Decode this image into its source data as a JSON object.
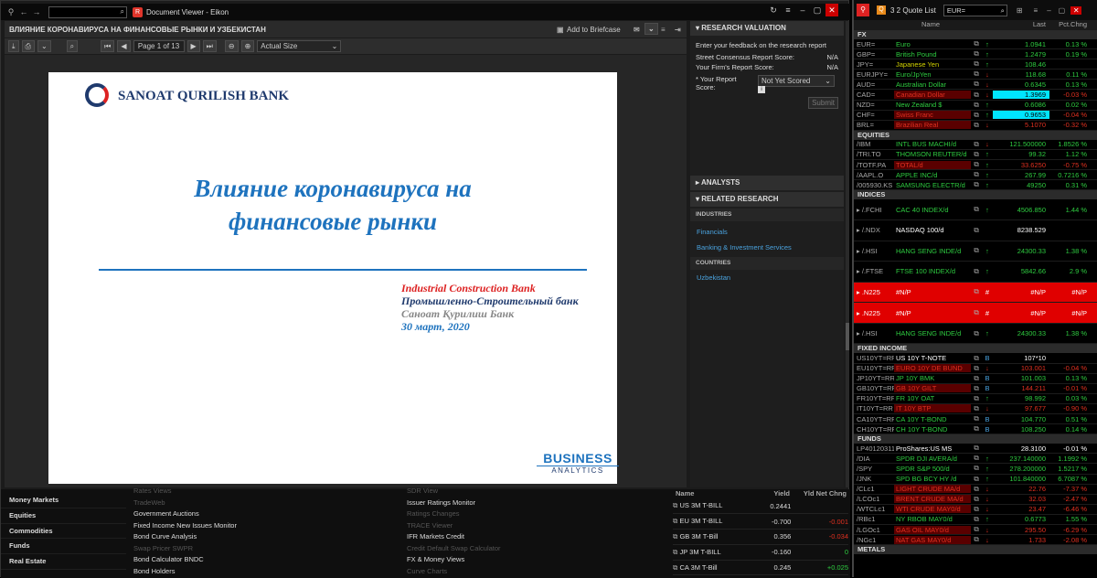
{
  "viewer": {
    "title": "Document Viewer - Eikon",
    "header": "ВЛИЯНИЕ КОРОНАВИРУСА НА ФИНАНСОВЫЕ РЫНКИ И УЗБЕКИСТАН",
    "briefcase": "Add to Briefcase",
    "page_label": "Page 1 of 13",
    "zoom": "Actual Size"
  },
  "doc": {
    "bank": "SANOAT QURILISH BANK",
    "title1": "Влияние коронавируса на",
    "title2": "финансовые рынки",
    "org_en": "Industrial Construction Bank",
    "org_ru": "Промышленно-Строительный банк",
    "org_uz": "Саноат Қурилиш Банк",
    "date": "30 март, 2020",
    "brand1": "BUSINESS",
    "brand2": "ANALYTICS"
  },
  "side": {
    "valuation": "RESEARCH VALUATION",
    "feedback": "Enter your feedback on the research report",
    "street_label": "Street Consensus Report Score:",
    "street_val": "N/A",
    "firm_label": "Your Firm's Report Score:",
    "firm_val": "N/A",
    "your_label": "* Your Report",
    "score_label": "Score:",
    "not_scored": "Not Yet Scored",
    "submit": "Submit",
    "analysts": "ANALYSTS",
    "related": "RELATED RESEARCH",
    "industries": "INDUSTRIES",
    "ind1": "Financials",
    "ind2": "Banking & Investment Services",
    "countries": "COUNTRIES",
    "country1": "Uzbekistan"
  },
  "bottom": {
    "cats": [
      "Money Markets",
      "Equities",
      "Commodities",
      "Funds",
      "Real Estate"
    ],
    "menu1": [
      {
        "t": "Rates Views",
        "dim": true
      },
      {
        "t": "TradeWeb",
        "dim": true
      },
      {
        "t": "Government Auctions",
        "dim": false
      },
      {
        "t": "Fixed Income New Issues Monitor",
        "dim": false
      },
      {
        "t": "Bond Curve Analysis",
        "dim": false
      },
      {
        "t": "Swap Pricer SWPR",
        "dim": true
      },
      {
        "t": "Bond Calculator BNDC",
        "dim": false
      },
      {
        "t": "Bond Holders",
        "dim": false
      }
    ],
    "menu2": [
      {
        "t": "SDR View",
        "dim": true
      },
      {
        "t": "Issuer Ratings Monitor",
        "dim": false
      },
      {
        "t": "Ratings Changes",
        "dim": true
      },
      {
        "t": "TRACE Viewer",
        "dim": true
      },
      {
        "t": "IFR Markets Credit",
        "dim": false
      },
      {
        "t": "Credit Default Swap Calculator",
        "dim": true
      },
      {
        "t": "FX & Money Views",
        "dim": false
      },
      {
        "t": "Curve Charts",
        "dim": true
      }
    ],
    "yh": [
      "Name",
      "Yield",
      "Yld Net Chng"
    ],
    "yields": [
      [
        "US 3M T-BILL",
        "0.2441",
        ""
      ],
      [
        "EU 3M T-BILL",
        "-0.700",
        "-0.001"
      ],
      [
        "GB 3M T-Bill",
        "0.356",
        "-0.034"
      ],
      [
        "JP 3M T-BILL",
        "-0.160",
        "0"
      ],
      [
        "CA 3M T-Bill",
        "0.245",
        "+0.025"
      ]
    ]
  },
  "quote": {
    "title": "3 2 Quote List",
    "search": "EUR=",
    "h": [
      "Name",
      "Last",
      "Pct.Chng"
    ],
    "sections": [
      {
        "name": "FX",
        "rows": [
          [
            "EUR=",
            "Euro",
            "up",
            "1.0941",
            "0.13 %",
            "g",
            "",
            "g"
          ],
          [
            "GBP=",
            "British Pound",
            "up",
            "1.2479",
            "0.19 %",
            "g",
            "",
            "g"
          ],
          [
            "JPY=",
            "Japanese Yen",
            "up",
            "108.46",
            "",
            "y",
            "",
            "g"
          ],
          [
            "EURJPY=",
            "Euro/JpYen",
            "dn",
            "118.68",
            "0.11 %",
            "g",
            "",
            "g"
          ],
          [
            "AUD=",
            "Australian Dollar",
            "dn",
            "0.6345",
            "0.13 %",
            "g",
            "",
            "g"
          ],
          [
            "CAD=",
            "Canadian Dollar",
            "dn",
            "1.3969",
            "-0.03 %",
            "r",
            "cy",
            "r"
          ],
          [
            "NZD=",
            "New Zealand $",
            "up",
            "0.6086",
            "0.02 %",
            "g",
            "",
            "g"
          ],
          [
            "CHF=",
            "Swiss Franc",
            "up",
            "0.9653",
            "-0.04 %",
            "r",
            "cy",
            "r"
          ],
          [
            "BRL=",
            "Brazilian Real",
            "dn",
            "5.1070",
            "-0.32 %",
            "r",
            "",
            "r"
          ]
        ]
      },
      {
        "name": "EQUITIES",
        "rows": [
          [
            "/IBM",
            "INTL BUS MACHI/d",
            "dn",
            "121.500000",
            "1.8526 %",
            "g",
            "",
            "g"
          ],
          [
            "/TRI.TO",
            "THOMSON REUTER/d",
            "up",
            "99.32",
            "1.12 %",
            "g",
            "",
            "g"
          ],
          [
            "/TOTF.PA",
            "TOTAL/d",
            "up",
            "33.6250",
            "-0.75 %",
            "r",
            "",
            "r"
          ],
          [
            "/AAPL.O",
            "APPLE INC/d",
            "up",
            "267.99",
            "0.7216 %",
            "g",
            "",
            "g"
          ],
          [
            "/005930.KS",
            "SAMSUNG ELECTR/d",
            "up",
            "49250",
            "0.31 %",
            "g",
            "",
            "g"
          ]
        ]
      },
      {
        "name": "INDICES",
        "tall": true,
        "rows": [
          [
            "/.FCHI",
            "CAC 40 INDEX/d",
            "up",
            "4506.850",
            "1.44 %",
            "g",
            "",
            "g"
          ],
          [
            "/.NDX",
            "NASDAQ 100/d",
            "",
            "8238.529",
            "",
            "w",
            "",
            "w"
          ],
          [
            "/.HSI",
            "HANG SENG INDE/d",
            "up",
            "24300.33",
            "1.38 %",
            "g",
            "",
            "g"
          ],
          [
            "/.FTSE",
            "FTSE 100 INDEX/d",
            "up",
            "5842.66",
            "2.9 %",
            "g",
            "",
            "g"
          ],
          [
            ".N225",
            "#N/P",
            "#",
            "#N/P",
            "#N/P",
            "w",
            "red",
            "w"
          ],
          [
            ".N225",
            "#N/P",
            "#",
            "#N/P",
            "#N/P",
            "w",
            "red",
            "w"
          ],
          [
            "/.HSI",
            "HANG SENG INDE/d",
            "up",
            "24300.33",
            "1.38 %",
            "g",
            "",
            "g"
          ]
        ]
      },
      {
        "name": "FIXED INCOME",
        "rows": [
          [
            "US10YT=RR",
            "US 10Y T-NOTE",
            "B",
            "107*10",
            "",
            "w",
            "",
            "w"
          ],
          [
            "EU10YT=RR",
            "EURO 10Y DE BUND",
            "dn",
            "103.001",
            "-0.04 %",
            "r",
            "",
            "r"
          ],
          [
            "JP10YT=RR",
            "JP 10Y BMK",
            "B",
            "101.003",
            "0.13 %",
            "g",
            "",
            "g"
          ],
          [
            "GB10YT=RR",
            "GB 10Y GILT",
            "B",
            "144.211",
            "-0.01 %",
            "r",
            "",
            "r"
          ],
          [
            "FR10YT=RR",
            "FR 10Y OAT",
            "up",
            "98.992",
            "0.03 %",
            "g",
            "",
            "g"
          ],
          [
            "IT10YT=RR",
            "IT 10Y BTP",
            "dn",
            "97.677",
            "-0.90 %",
            "r",
            "",
            "r"
          ],
          [
            "CA10YT=RR",
            "CA 10Y T-BOND",
            "B",
            "104.770",
            "0.51 %",
            "g",
            "",
            "g"
          ],
          [
            "CH10YT=RR",
            "CH 10Y T-BOND",
            "B",
            "108.250",
            "0.14 %",
            "g",
            "",
            "g"
          ]
        ]
      },
      {
        "name": "FUNDS",
        "rows": [
          [
            "LP40120311",
            "ProShares:US MS",
            "",
            "28.3100",
            "-0.01 %",
            "w",
            "",
            "w"
          ],
          [
            "/DIA",
            "SPDR DJI AVERA/d",
            "up",
            "237.140000",
            "1.1992 %",
            "g",
            "",
            "g"
          ],
          [
            "/SPY",
            "SPDR S&P 500/d",
            "up",
            "278.200000",
            "1.5217 %",
            "g",
            "",
            "g"
          ],
          [
            "/JNK",
            "SPD BG BCY HY /d",
            "up",
            "101.840000",
            "6.7087 %",
            "g",
            "",
            "g"
          ],
          [
            "/CLc1",
            "LIGHT CRUDE MA/d",
            "dn",
            "22.76",
            "-7.37 %",
            "r",
            "",
            "r"
          ],
          [
            "/LCOc1",
            "BRENT CRUDE MA/d",
            "dn",
            "32.03",
            "-2.47 %",
            "r",
            "",
            "r"
          ],
          [
            "/WTCLc1",
            "WTI CRUDE MAY0/d",
            "dn",
            "23.47",
            "-6.46 %",
            "r",
            "",
            "r"
          ],
          [
            "/RBc1",
            "NY RBOB MAY0/d",
            "up",
            "0.6773",
            "1.55 %",
            "g",
            "",
            "g"
          ],
          [
            "/LGOc1",
            "GAS OIL MAY0/d",
            "dn",
            "295.50",
            "-6.29 %",
            "r",
            "",
            "r"
          ],
          [
            "/NGc1",
            "NAT GAS MAY0/d",
            "dn",
            "1.733",
            "-2.08 %",
            "r",
            "",
            "r"
          ]
        ]
      },
      {
        "name": "METALS",
        "rows": []
      }
    ]
  }
}
